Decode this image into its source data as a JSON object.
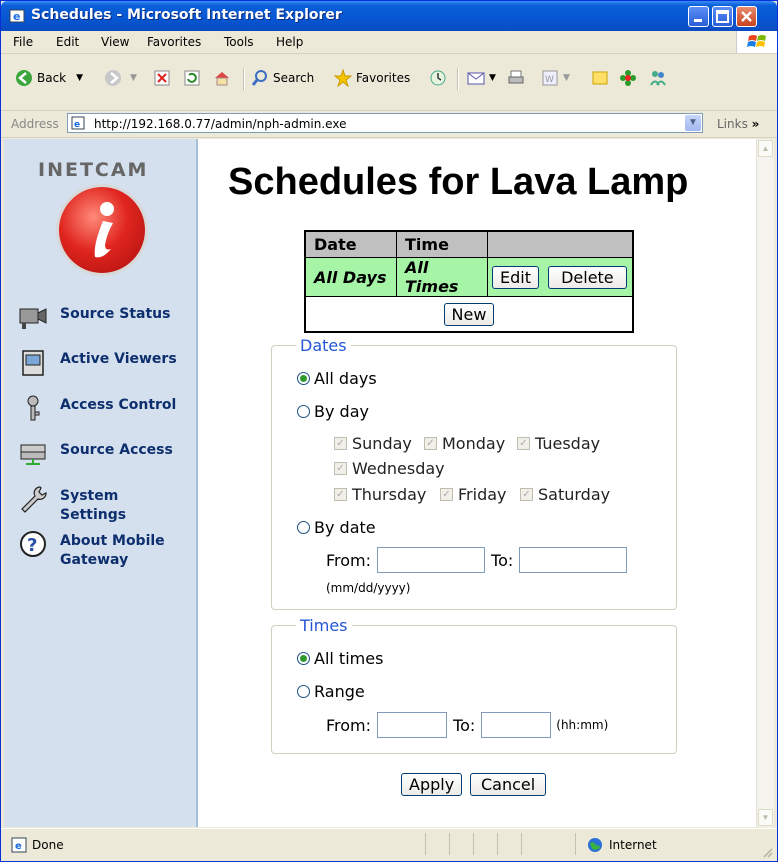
{
  "window": {
    "title": "Schedules - Microsoft Internet Explorer"
  },
  "menu": [
    "File",
    "Edit",
    "View",
    "Favorites",
    "Tools",
    "Help"
  ],
  "toolbar": {
    "back": "Back",
    "search": "Search",
    "favorites": "Favorites"
  },
  "address": {
    "label": "Address",
    "url": "http://192.168.0.77/admin/nph-admin.exe",
    "links": "Links"
  },
  "sidebar": {
    "logo": "Inetcam",
    "items": [
      {
        "label": "Source Status"
      },
      {
        "label": "Active Viewers"
      },
      {
        "label": "Access Control"
      },
      {
        "label": "Source Access"
      },
      {
        "label": "System Settings"
      },
      {
        "label": "About Mobile Gateway"
      }
    ]
  },
  "main": {
    "title": "Schedules for Lava Lamp",
    "table": {
      "headers": [
        "Date",
        "Time"
      ],
      "row": {
        "date": "All Days",
        "time": "All Times"
      },
      "edit": "Edit",
      "delete": "Delete",
      "new": "New"
    },
    "dates": {
      "legend": "Dates",
      "all_days": "All days",
      "by_day": "By day",
      "days": [
        "Sunday",
        "Monday",
        "Tuesday",
        "Wednesday",
        "Thursday",
        "Friday",
        "Saturday"
      ],
      "by_date": "By date",
      "from": "From:",
      "to": "To:",
      "format": "(mm/dd/yyyy)"
    },
    "times": {
      "legend": "Times",
      "all_times": "All times",
      "range": "Range",
      "from": "From:",
      "to": "To:",
      "format": "(hh:mm)"
    },
    "apply": "Apply",
    "cancel": "Cancel"
  },
  "status": {
    "left": "Done",
    "zone": "Internet"
  }
}
